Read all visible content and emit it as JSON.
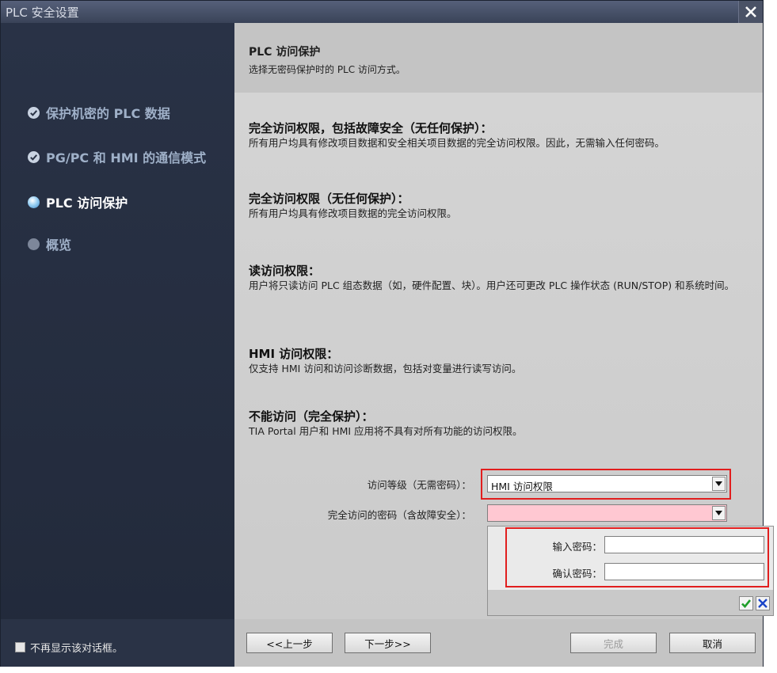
{
  "window": {
    "title": "PLC 安全设置"
  },
  "sidebar": {
    "steps": [
      {
        "label": "保护机密的 PLC 数据",
        "state": "done"
      },
      {
        "label": "PG/PC 和 HMI 的通信模式",
        "state": "done"
      },
      {
        "label": "PLC 访问保护",
        "state": "current"
      },
      {
        "label": "概览",
        "state": "future"
      }
    ]
  },
  "header": {
    "title": "PLC 访问保护",
    "subtitle": "选择无密码保护时的 PLC 访问方式。"
  },
  "options": [
    {
      "title": "完全访问权限，包括故障安全（无任何保护）：",
      "desc": "所有用户均具有修改项目数据和安全相关项目数据的完全访问权限。因此，无需输入任何密码。"
    },
    {
      "title": "完全访问权限（无任何保护）：",
      "desc": "所有用户均具有修改项目数据的完全访问权限。"
    },
    {
      "title": "读访问权限：",
      "desc": "用户将只读访问 PLC 组态数据（如，硬件配置、块）。用户还可更改 PLC 操作状态 (RUN/STOP) 和系统时间。"
    },
    {
      "title": "HMI 访问权限：",
      "desc": "仅支持 HMI 访问和访问诊断数据，包括对变量进行读写访问。"
    },
    {
      "title": "不能访问（完全保护）：",
      "desc": "TIA Portal 用户和 HMI 应用将不具有对所有功能的访问权限。"
    }
  ],
  "form": {
    "access_level_label": "访问等级（无需密码）：",
    "access_level_value": "HMI 访问权限",
    "password_label": "完全访问的密码（含故障安全）：",
    "password_value": ""
  },
  "password_popup": {
    "enter_label": "输入密码：",
    "confirm_label": "确认密码："
  },
  "footer": {
    "dont_show_label": "不再显示该对话框。",
    "prev_label": "<<上一步",
    "next_label": "下一步>>",
    "finish_label": "完成",
    "cancel_label": "取消"
  },
  "colors": {
    "highlight": "#e11e1e",
    "password_required": "#ffc8d2"
  }
}
